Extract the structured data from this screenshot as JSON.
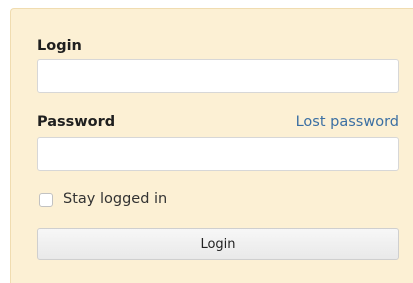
{
  "login_form": {
    "login_label": "Login",
    "login_value": "",
    "password_label": "Password",
    "password_value": "",
    "lost_password_link": "Lost password",
    "stay_logged_in_label": "Stay logged in",
    "stay_logged_in_checked": false,
    "submit_label": "Login"
  },
  "colors": {
    "panel_background": "#fcf0d4",
    "link": "#3b6fa3"
  }
}
